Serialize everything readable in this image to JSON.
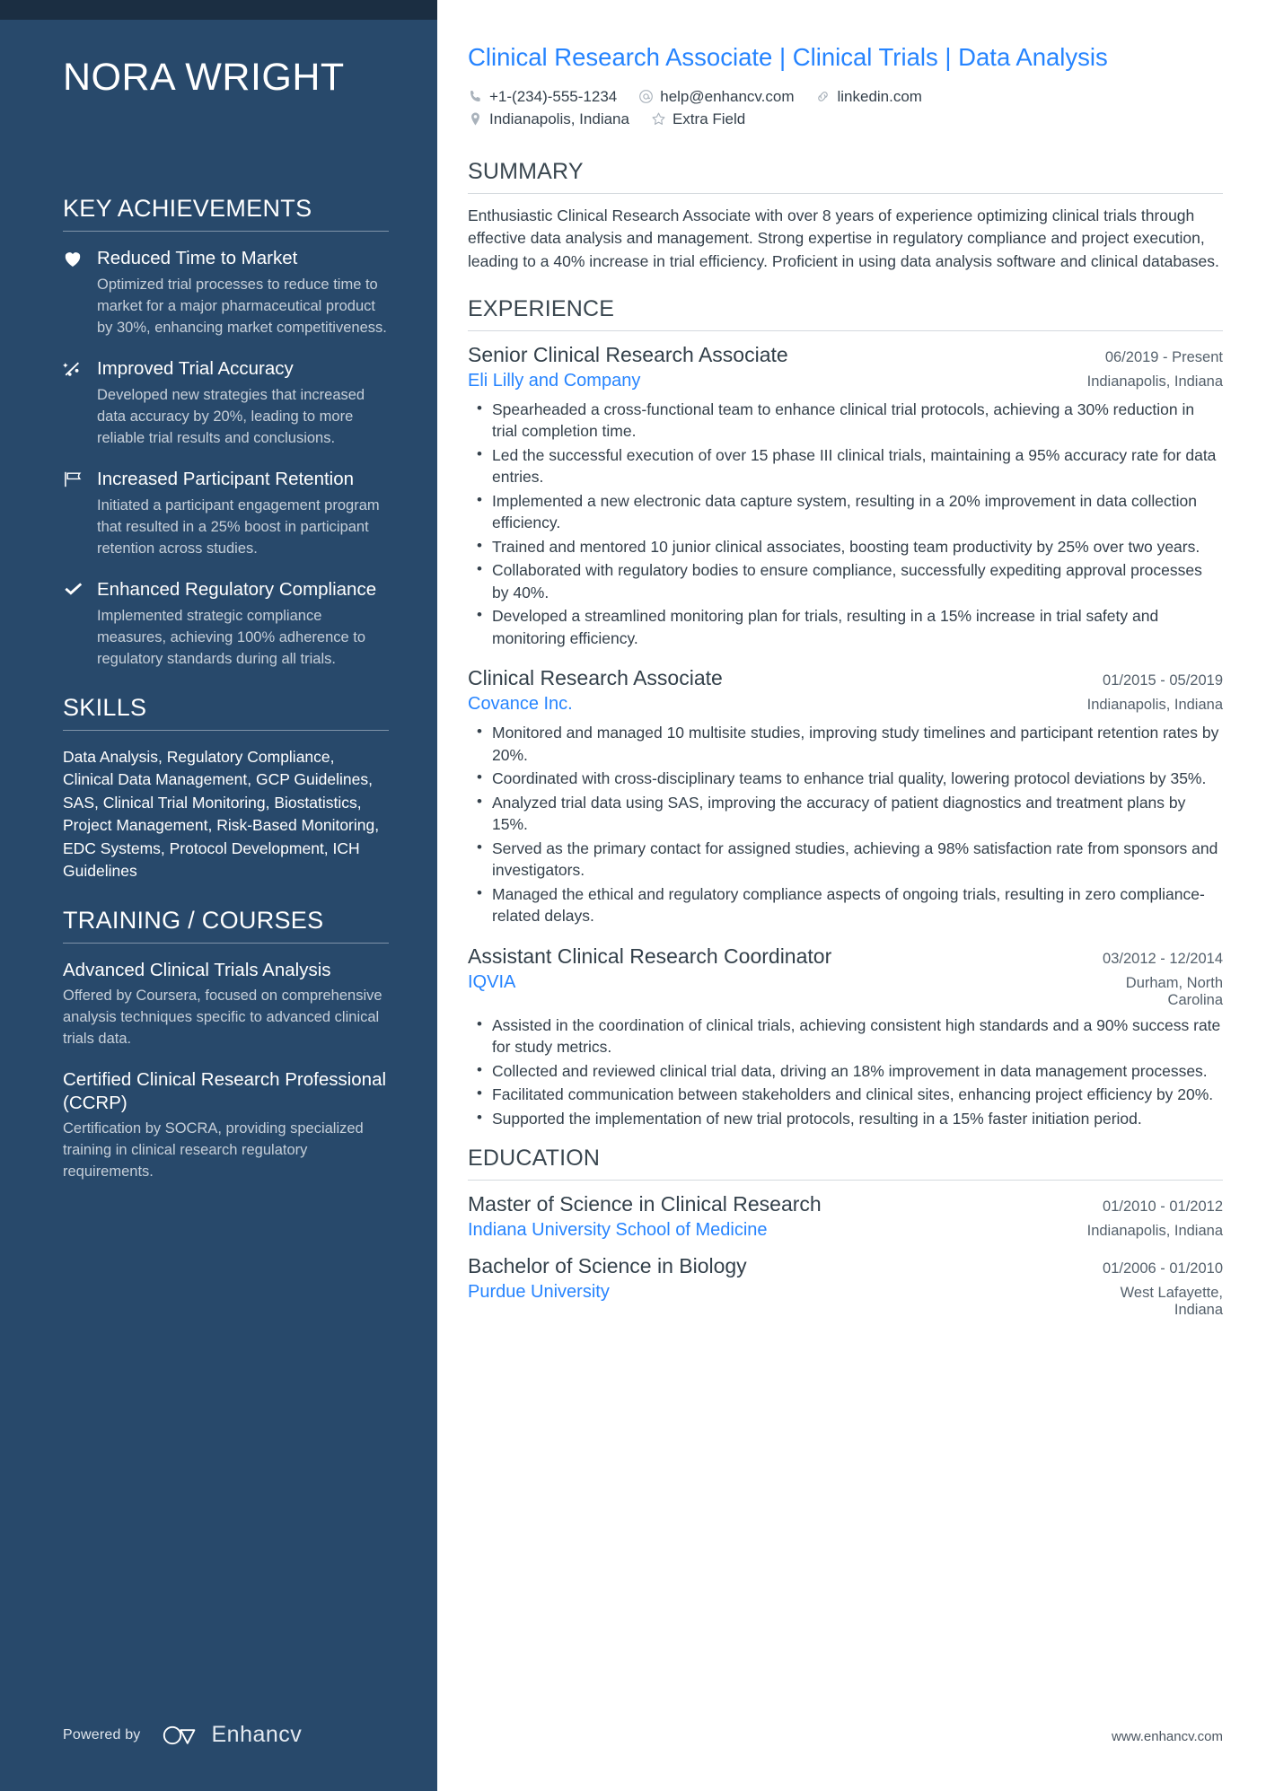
{
  "sidebar": {
    "name": "NORA WRIGHT",
    "key_achievements": {
      "heading": "KEY ACHIEVEMENTS",
      "items": [
        {
          "icon": "heart-icon",
          "title": "Reduced Time to Market",
          "description": "Optimized trial processes to reduce time to market for a major pharmaceutical product by 30%, enhancing market competitiveness."
        },
        {
          "icon": "scatter-chart-icon",
          "title": "Improved Trial Accuracy",
          "description": "Developed new strategies that increased data accuracy by 20%, leading to more reliable trial results and conclusions."
        },
        {
          "icon": "flag-icon",
          "title": "Increased Participant Retention",
          "description": "Initiated a participant engagement program that resulted in a 25% boost in participant retention across studies."
        },
        {
          "icon": "check-icon",
          "title": "Enhanced Regulatory Compliance",
          "description": "Implemented strategic compliance measures, achieving 100% adherence to regulatory standards during all trials."
        }
      ]
    },
    "skills": {
      "heading": "SKILLS",
      "text": "Data Analysis, Regulatory Compliance, Clinical Data Management, GCP Guidelines, SAS, Clinical Trial Monitoring, Biostatistics, Project Management, Risk-Based Monitoring, EDC Systems, Protocol Development, ICH Guidelines"
    },
    "training": {
      "heading": "TRAINING / COURSES",
      "items": [
        {
          "title": "Advanced Clinical Trials Analysis",
          "description": "Offered by Coursera, focused on comprehensive analysis techniques specific to advanced clinical trials data."
        },
        {
          "title": "Certified Clinical Research Professional (CCRP)",
          "description": "Certification by SOCRA, providing specialized training in clinical research regulatory requirements."
        }
      ]
    },
    "footer": {
      "powered_label": "Powered by",
      "brand": "Enhancv"
    }
  },
  "main": {
    "headline": "Clinical Research Associate | Clinical Trials | Data Analysis",
    "contacts": [
      [
        {
          "icon": "phone-icon",
          "text": "+1-(234)-555-1234"
        },
        {
          "icon": "email-icon",
          "text": "help@enhancv.com"
        },
        {
          "icon": "link-icon",
          "text": "linkedin.com"
        }
      ],
      [
        {
          "icon": "location-pin-icon",
          "text": "Indianapolis, Indiana"
        },
        {
          "icon": "star-icon",
          "text": "Extra Field"
        }
      ]
    ],
    "summary": {
      "heading": "SUMMARY",
      "text": "Enthusiastic Clinical Research Associate with over 8 years of experience optimizing clinical trials through effective data analysis and management. Strong expertise in regulatory compliance and project execution, leading to a 40% increase in trial efficiency. Proficient in using data analysis software and clinical databases."
    },
    "experience": {
      "heading": "EXPERIENCE",
      "entries": [
        {
          "title": "Senior Clinical Research Associate",
          "dates": "06/2019 - Present",
          "organization": "Eli Lilly and Company",
          "location": "Indianapolis, Indiana",
          "bullets": [
            "Spearheaded a cross-functional team to enhance clinical trial protocols, achieving a 30% reduction in trial completion time.",
            "Led the successful execution of over 15 phase III clinical trials, maintaining a 95% accuracy rate for data entries.",
            "Implemented a new electronic data capture system, resulting in a 20% improvement in data collection efficiency.",
            "Trained and mentored 10 junior clinical associates, boosting team productivity by 25% over two years.",
            "Collaborated with regulatory bodies to ensure compliance, successfully expediting approval processes by 40%.",
            "Developed a streamlined monitoring plan for trials, resulting in a 15% increase in trial safety and monitoring efficiency."
          ]
        },
        {
          "title": "Clinical Research Associate",
          "dates": "01/2015 - 05/2019",
          "organization": "Covance Inc.",
          "location": "Indianapolis, Indiana",
          "bullets": [
            "Monitored and managed 10 multisite studies, improving study timelines and participant retention rates by 20%.",
            "Coordinated with cross-disciplinary teams to enhance trial quality, lowering protocol deviations by 35%.",
            "Analyzed trial data using SAS, improving the accuracy of patient diagnostics and treatment plans by 15%.",
            "Served as the primary contact for assigned studies, achieving a 98% satisfaction rate from sponsors and investigators.",
            "Managed the ethical and regulatory compliance aspects of ongoing trials, resulting in zero compliance-related delays."
          ]
        },
        {
          "title": "Assistant Clinical Research Coordinator",
          "dates": "03/2012 - 12/2014",
          "organization": "IQVIA",
          "location": "Durham, North Carolina",
          "bullets": [
            "Assisted in the coordination of clinical trials, achieving consistent high standards and a 90% success rate for study metrics.",
            "Collected and reviewed clinical trial data, driving an 18% improvement in data management processes.",
            "Facilitated communication between stakeholders and clinical sites, enhancing project efficiency by 20%.",
            "Supported the implementation of new trial protocols, resulting in a 15% faster initiation period."
          ]
        }
      ]
    },
    "education": {
      "heading": "EDUCATION",
      "entries": [
        {
          "title": "Master of Science in Clinical Research",
          "dates": "01/2010 - 01/2012",
          "organization": "Indiana University School of Medicine",
          "location": "Indianapolis, Indiana"
        },
        {
          "title": "Bachelor of Science in Biology",
          "dates": "01/2006 - 01/2010",
          "organization": "Purdue University",
          "location": "West Lafayette, Indiana"
        }
      ]
    },
    "site_url": "www.enhancv.com"
  },
  "colors": {
    "sidebar_bg": "#28496b",
    "sidebar_topbar": "#1b2e42",
    "accent_link": "#2684ff",
    "body_text": "#34404b"
  }
}
